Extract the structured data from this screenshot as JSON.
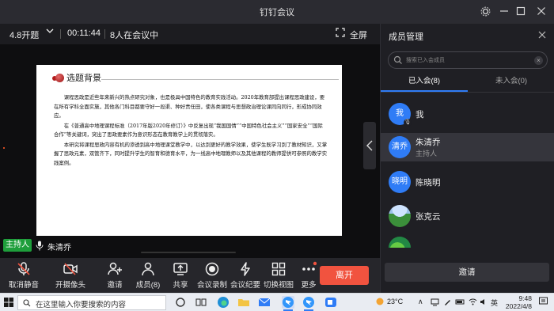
{
  "window": {
    "title": "钉钉会议",
    "controls": [
      "settings-icon",
      "minimize-icon",
      "restore-icon",
      "close-icon"
    ]
  },
  "meeting": {
    "title": "4.8开题",
    "duration": "00:11:44",
    "participants_status": "8人在会议中",
    "fullscreen_label": "全屏"
  },
  "slide": {
    "heading": "选题背景",
    "paragraphs": [
      "课程思政是近些年来新兴的热点研究对象，也是极具中国特色的教育实践活动。2020年教育部提出课程思政建设，要在所有学科全面实施，其他各门科目都要守好一段渠、种好责任田，使各类课程与思想政治理论课同向同行，形成协同效应。",
      "在《普通高中地理课程标准（2017年版2020年修订）》中反复出现“我国国情”“中国特色社会主义”“国家安全”“国际合作”等关键词，突出了思政要素作为意识形态在教育教学上的贯彻落实。",
      "本研究将课程思政内容有机的渗透到高中地理课堂教学中，以达到更好的教学效果，使学生既学习到了教材知识，又掌握了思政元素，双管齐下，同时提升学生的智育和德育水平，为一线高中地理教师以及其他课程的教师提供可参照的教学实践案例。"
    ]
  },
  "speaker": {
    "role_tag": "主持人",
    "name": "朱清乔"
  },
  "toolbar": {
    "items": [
      {
        "label": "取消静音",
        "icon": "mic-muted-icon"
      },
      {
        "label": "开摄像头",
        "icon": "camera-off-icon"
      },
      {
        "label": "邀请",
        "icon": "add-person-icon"
      },
      {
        "label": "成员(8)",
        "icon": "members-icon"
      },
      {
        "label": "共享",
        "icon": "share-screen-icon"
      },
      {
        "label": "会议录制",
        "icon": "record-icon"
      },
      {
        "label": "会议纪要",
        "icon": "flash-notes-icon"
      },
      {
        "label": "切换视图",
        "icon": "grid-view-icon"
      },
      {
        "label": "更多",
        "icon": "more-icon"
      }
    ],
    "leave_label": "离开"
  },
  "panel": {
    "title": "成员管理",
    "search_placeholder": "搜索已入会成员",
    "tabs": [
      {
        "label": "已入会(8)",
        "active": true
      },
      {
        "label": "未入会(0)",
        "active": false
      }
    ],
    "members": [
      {
        "avatar": "我",
        "name": "我",
        "role": ""
      },
      {
        "avatar": "清乔",
        "name": "朱清乔",
        "role": "主持人"
      },
      {
        "avatar": "晓明",
        "name": "陈晓明",
        "role": ""
      },
      {
        "avatar": "",
        "name": "张克云",
        "role": ""
      },
      {
        "avatar": "",
        "name": "",
        "role": ""
      }
    ],
    "invite_label": "邀请"
  },
  "taskbar": {
    "search_placeholder": "在这里输入你要搜索的内容",
    "weather": "23°C",
    "ime": "英",
    "time": "9:48",
    "date": "2022/4/8"
  },
  "colors": {
    "accent": "#2f7cf6",
    "leave": "#f1533f",
    "host_tag": "#1e9e3b",
    "background": "#1f1f24"
  }
}
